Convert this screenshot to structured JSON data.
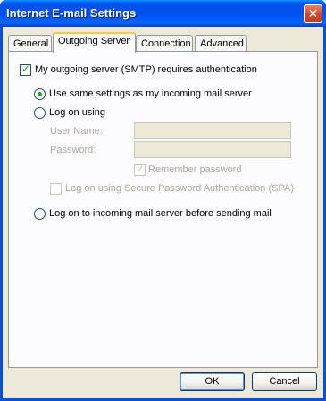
{
  "window": {
    "title": "Internet E-mail Settings",
    "close_icon": "close-icon"
  },
  "tabs": [
    {
      "label": "General",
      "active": false
    },
    {
      "label": "Outgoing Server",
      "active": true
    },
    {
      "label": "Connection",
      "active": false
    },
    {
      "label": "Advanced",
      "active": false
    }
  ],
  "panel": {
    "requires_auth": {
      "label": "My outgoing server (SMTP) requires authentication",
      "checked": true
    },
    "same_settings": {
      "label": "Use same settings as my incoming mail server",
      "selected": true
    },
    "log_on_using": {
      "label": "Log on using",
      "selected": false
    },
    "user_name": {
      "label": "User Name:",
      "value": ""
    },
    "password": {
      "label": "Password:",
      "value": ""
    },
    "remember_password": {
      "label": "Remember password",
      "checked": true,
      "enabled": false
    },
    "spa": {
      "label": "Log on using Secure Password Authentication (SPA)",
      "checked": false,
      "enabled": false
    },
    "log_on_incoming": {
      "label": "Log on to incoming mail server before sending mail",
      "selected": false
    }
  },
  "buttons": {
    "ok": "OK",
    "cancel": "Cancel"
  }
}
